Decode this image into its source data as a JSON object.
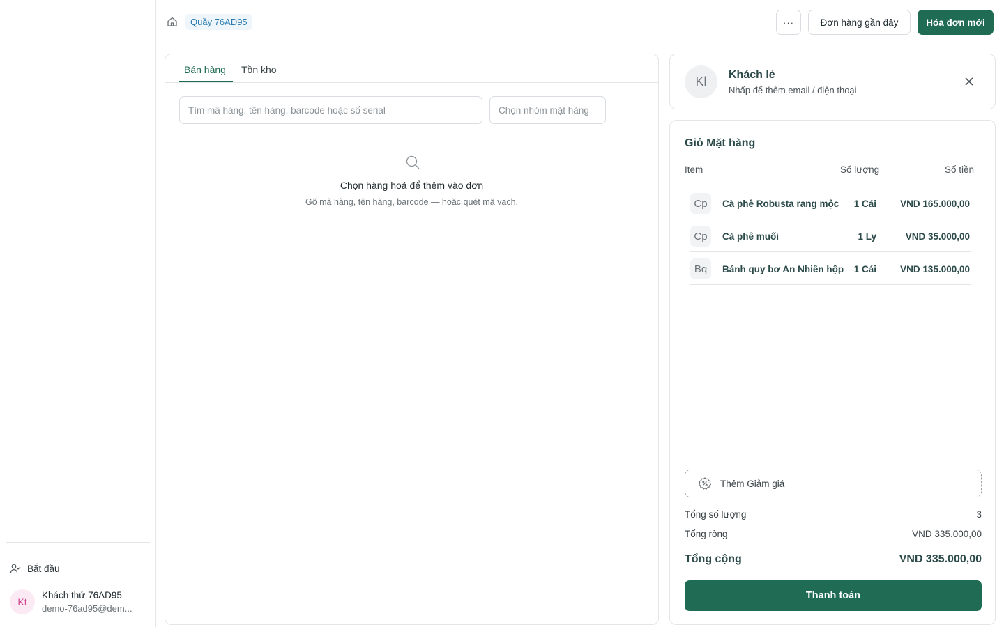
{
  "sidebar": {
    "start_label": "Bắt đầu",
    "user": {
      "initials": "Kt",
      "name": "Khách thử 76AD95",
      "email": "demo-76ad95@dem..."
    }
  },
  "header": {
    "store_badge": "Quầy 76AD95",
    "more_label": "···",
    "recent_orders_label": "Đơn hàng gần đây",
    "new_invoice_label": "Hóa đơn mới"
  },
  "left_panel": {
    "tabs": [
      "Bán hàng",
      "Tồn kho"
    ],
    "active_tab": "Bán hàng",
    "search_placeholder": "Tìm mã hàng, tên hàng, barcode hoặc số serial",
    "group_placeholder": "Chọn nhóm mặt hàng",
    "empty_title": "Chọn hàng hoá để thêm vào đơn",
    "empty_subtitle": "Gõ mã hàng, tên hàng, barcode — hoặc quét mã vạch."
  },
  "customer": {
    "initials": "Kl",
    "name": "Khách lẻ",
    "hint": "Nhấp để thêm email / điện thoại"
  },
  "cart": {
    "title": "Giỏ Mặt hàng",
    "columns": {
      "item": "Item",
      "qty": "Số lượng",
      "amount": "Số tiền"
    },
    "items": [
      {
        "icon": "Cp",
        "name": "Cà phê Robusta rang mộc",
        "qty": "1 Cái",
        "amount": "VND 165.000,00"
      },
      {
        "icon": "Cp",
        "name": "Cà phê muối",
        "qty": "1 Ly",
        "amount": "VND 35.000,00"
      },
      {
        "icon": "Bq",
        "name": "Bánh quy bơ An Nhiên hộp",
        "qty": "1 Cái",
        "amount": "VND 135.000,00"
      }
    ],
    "discount_label": "Thêm Giảm giá",
    "total_qty_label": "Tổng số lượng",
    "total_qty_value": "3",
    "net_label": "Tổng ròng",
    "net_value": "VND 335.000,00",
    "grand_label": "Tổng cộng",
    "grand_value": "VND 335.000,00",
    "pay_label": "Thanh toán"
  },
  "colors": {
    "primary": "#1f6b54",
    "badge_bg": "#eef6fb",
    "badge_text": "#2b7bb0",
    "avatar_pink": "#d0458f"
  }
}
